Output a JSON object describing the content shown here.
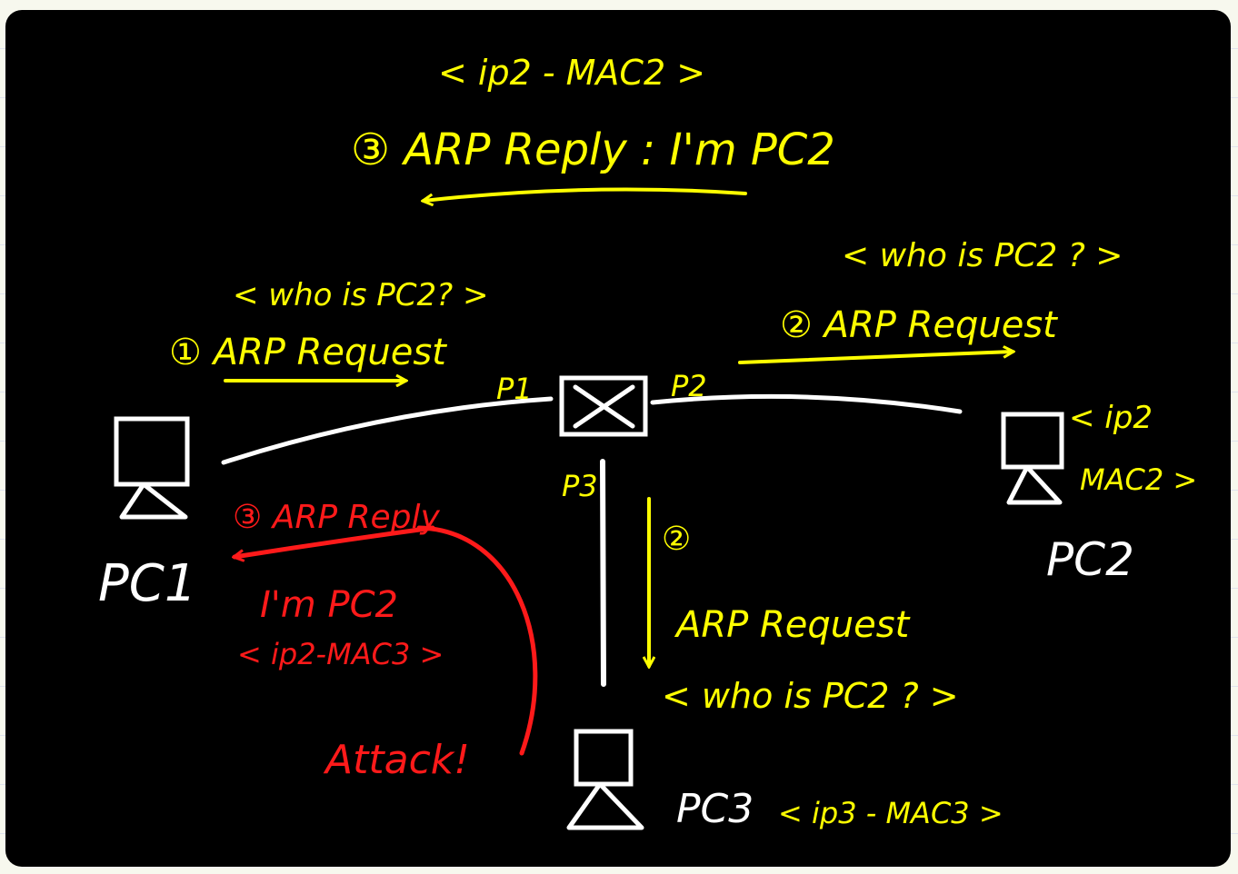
{
  "colors": {
    "background": "#000000",
    "white": "#ffffff",
    "yellow": "#ffff00",
    "red": "#ff1a1a"
  },
  "hosts": {
    "pc1": "PC1",
    "pc2": "PC2",
    "pc3": "PC3"
  },
  "ports": {
    "p1": "P1",
    "p2": "P2",
    "p3": "P3"
  },
  "switch_icon": "switch-icon",
  "step1": {
    "label": "① ARP Request",
    "payload": "< who is PC2? >"
  },
  "step2_right": {
    "label": "② ARP Request",
    "payload": "< who is PC2 ? >"
  },
  "step2_down": {
    "num": "②",
    "label": "ARP Request",
    "payload": "< who is PC2 ? >"
  },
  "step3_top": {
    "payload": "< ip2 - MAC2 >",
    "label": "③ ARP Reply : I'm PC2"
  },
  "step3_attack": {
    "label": "③ ARP Reply",
    "claim": "I'm PC2",
    "payload": "< ip2-MAC3 >",
    "attack": "Attack!"
  },
  "pc2_binding": {
    "line1": "< ip2",
    "line2": "MAC2 >"
  },
  "pc3_binding": "< ip3 - MAC3 >"
}
